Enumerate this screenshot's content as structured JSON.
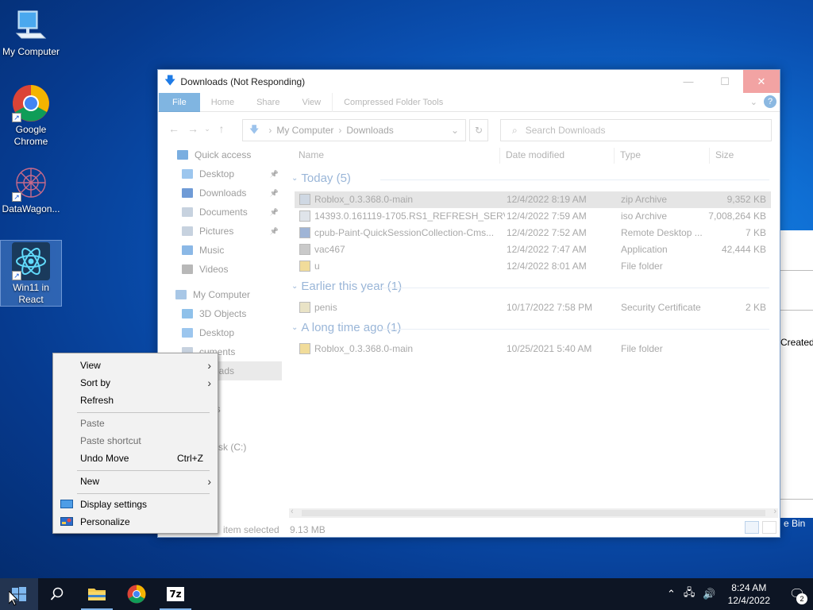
{
  "desktop": {
    "icons": [
      {
        "label": "My Computer"
      },
      {
        "label": "Google Chrome"
      },
      {
        "label": "DataWagon..."
      },
      {
        "label": "Win11 in React"
      }
    ]
  },
  "bg_window": {
    "text1": "Created",
    "text2": "e Bin"
  },
  "explorer": {
    "title": "Downloads (Not Responding)",
    "ribbon_tabs": [
      "File",
      "Home",
      "Share",
      "View",
      "Compressed Folder Tools"
    ],
    "address": {
      "root": "My Computer",
      "current": "Downloads"
    },
    "search_placeholder": "Search Downloads",
    "nav": [
      {
        "label": "Quick access",
        "color": "#7aaee0",
        "pinned": false,
        "selected": false
      },
      {
        "label": "Desktop",
        "color": "#9cc6ee",
        "pinned": true,
        "selected": false
      },
      {
        "label": "Downloads",
        "color": "#6f9bd6",
        "pinned": true,
        "selected": false
      },
      {
        "label": "Documents",
        "color": "#c7d2df",
        "pinned": true,
        "selected": false
      },
      {
        "label": "Pictures",
        "color": "#c7d2df",
        "pinned": true,
        "selected": false
      },
      {
        "label": "Music",
        "color": "#8bb8e6",
        "pinned": false,
        "selected": false
      },
      {
        "label": "Videos",
        "color": "#b8b8b8",
        "pinned": false,
        "selected": false
      },
      {
        "label": "My Computer",
        "color": "#a8c7e6",
        "pinned": false,
        "selected": false
      },
      {
        "label": "3D Objects",
        "color": "#8fc1ea",
        "pinned": false,
        "selected": false
      },
      {
        "label": "Desktop",
        "color": "#9cc6ee",
        "pinned": false,
        "selected": false
      },
      {
        "label": "cuments",
        "color": "#c7d2df",
        "pinned": false,
        "selected": false
      },
      {
        "label": "wnloads",
        "color": "#6f9bd6",
        "pinned": false,
        "selected": true
      },
      {
        "label": "sic",
        "color": "#8bb8e6",
        "pinned": false,
        "selected": false
      },
      {
        "label": "tures",
        "color": "#c7d2df",
        "pinned": false,
        "selected": false
      },
      {
        "label": "eos",
        "color": "#b8b8b8",
        "pinned": false,
        "selected": false
      },
      {
        "label": "al Disk (C:)",
        "color": "#c7c7c7",
        "pinned": false,
        "selected": false
      },
      {
        "label": "ork",
        "color": "#a8c7e6",
        "pinned": false,
        "selected": false
      }
    ],
    "columns": {
      "name": "Name",
      "date": "Date modified",
      "type": "Type",
      "size": "Size"
    },
    "groups": [
      {
        "label": "Today (5)",
        "files": [
          {
            "name": "Roblox_0.3.368.0-main",
            "date": "12/4/2022 8:19 AM",
            "type": "zip Archive",
            "size": "9,352 KB",
            "icon": "zip-icon",
            "selected": true
          },
          {
            "name": "14393.0.161119-1705.RS1_REFRESH_SERV...",
            "date": "12/4/2022 7:59 AM",
            "type": "iso Archive",
            "size": "7,008,264 KB",
            "icon": "iso-icon",
            "selected": false
          },
          {
            "name": "cpub-Paint-QuickSessionCollection-Cms...",
            "date": "12/4/2022 7:52 AM",
            "type": "Remote Desktop ...",
            "size": "7 KB",
            "icon": "rdp-icon",
            "selected": false
          },
          {
            "name": "vac467",
            "date": "12/4/2022 7:47 AM",
            "type": "Application",
            "size": "42,444 KB",
            "icon": "app-icon",
            "selected": false
          },
          {
            "name": "u",
            "date": "12/4/2022 8:01 AM",
            "type": "File folder",
            "size": "",
            "icon": "folder-icon",
            "selected": false
          }
        ]
      },
      {
        "label": "Earlier this year (1)",
        "files": [
          {
            "name": "penis",
            "date": "10/17/2022 7:58 PM",
            "type": "Security Certificate",
            "size": "2 KB",
            "icon": "certificate-icon",
            "selected": false
          }
        ]
      },
      {
        "label": "A long time ago (1)",
        "files": [
          {
            "name": "Roblox_0.3.368.0-main",
            "date": "10/25/2021 5:40 AM",
            "type": "File folder",
            "size": "",
            "icon": "folder-icon",
            "selected": false
          }
        ]
      }
    ],
    "status": {
      "selected": "item selected",
      "size": "9.13 MB"
    }
  },
  "context_menu": {
    "view": "View",
    "sort_by": "Sort by",
    "refresh": "Refresh",
    "paste": "Paste",
    "paste_shortcut": "Paste shortcut",
    "undo_move": "Undo Move",
    "undo_shortcut": "Ctrl+Z",
    "new": "New",
    "display_settings": "Display settings",
    "personalize": "Personalize"
  },
  "taskbar": {
    "time": "8:24 AM",
    "date": "12/4/2022",
    "notification_count": "2",
    "archive_label": "7z"
  }
}
